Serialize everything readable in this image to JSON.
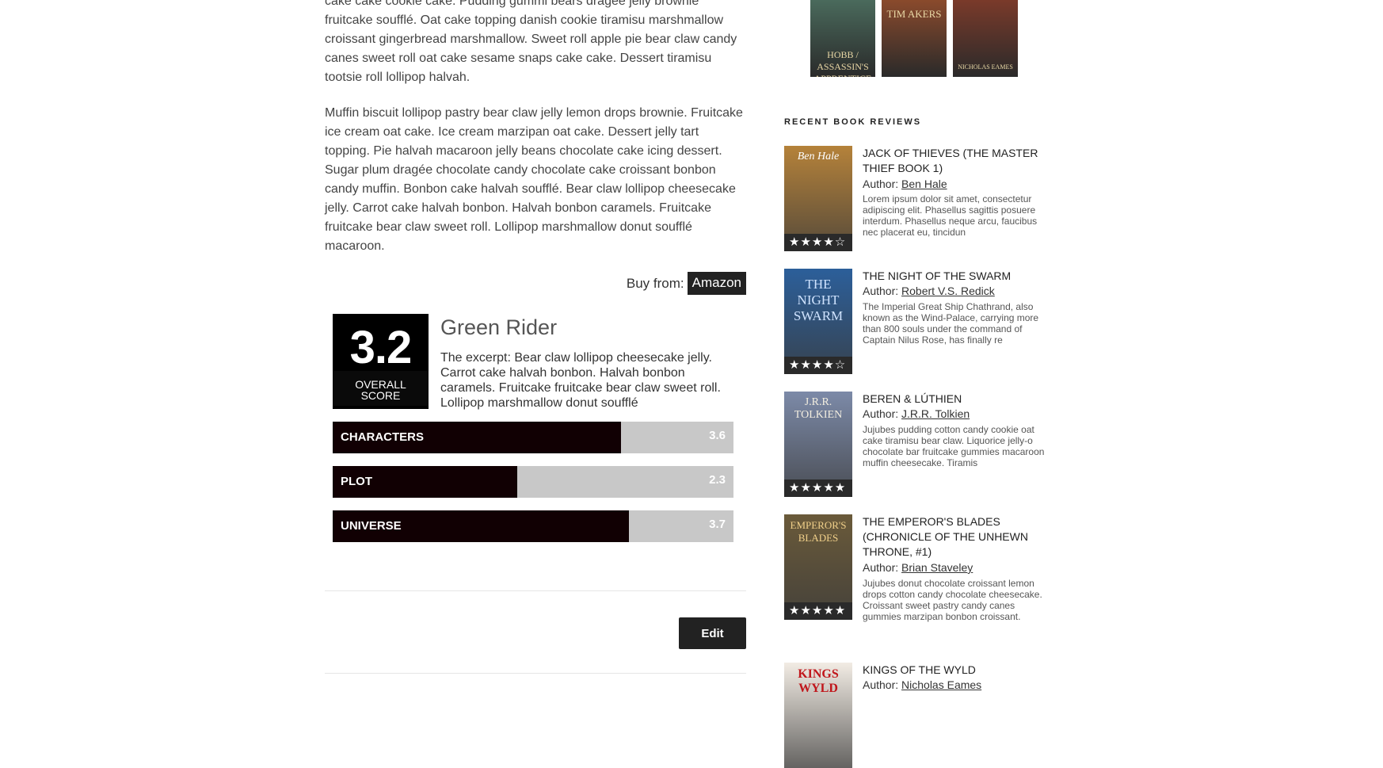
{
  "article": {
    "para1": "cake cake cookie cake. Pudding gummi bears dragée jelly brownie fruitcake soufflé. Oat cake topping danish cookie tiramisu marshmallow croissant gingerbread marshmallow. Sweet roll apple pie bear claw candy canes sweet roll oat cake sesame snaps cake cake. Dessert tiramisu tootsie roll lollipop halvah.",
    "para2": "Muffin biscuit lollipop pastry bear claw jelly lemon drops brownie. Fruitcake ice cream oat cake. Ice cream marzipan oat cake. Dessert jelly tart topping. Pie halvah macaroon jelly beans chocolate cake icing dessert. Sugar plum dragée chocolate candy chocolate cake croissant bonbon candy muffin. Bonbon cake halvah soufflé. Bear claw lollipop cheesecake jelly. Carrot cake halvah bonbon. Halvah bonbon caramels. Fruitcake fruitcake bear claw sweet roll. Lollipop marshmallow donut soufflé macaroon.",
    "buy_label": "Buy from:",
    "buy_store": "Amazon"
  },
  "review": {
    "score": "3.2",
    "score_label": "OVERALL SCORE",
    "title": "Green Rider",
    "excerpt": "The excerpt: Bear claw lollipop cheesecake jelly. Carrot cake halvah bonbon. Halvah bonbon caramels. Fruitcake fruitcake bear claw sweet roll. Lollipop marshmallow donut soufflé",
    "bars": [
      {
        "label": "CHARACTERS",
        "value": "3.6",
        "fraction": 0.72
      },
      {
        "label": "PLOT",
        "value": "2.3",
        "fraction": 0.46
      },
      {
        "label": "UNIVERSE",
        "value": "3.7",
        "fraction": 0.74
      }
    ]
  },
  "edit_label": "Edit",
  "sidebar": {
    "top_covers": [
      {
        "text": "HOBB / ASSASSIN'S APPRENTICE",
        "color": "#4a6a5c"
      },
      {
        "text": "TIM AKERS",
        "color": "#8a4a2c"
      },
      {
        "text": "NICHOLAS EAMES",
        "color": "#7a3a2a"
      }
    ],
    "heading": "RECENT BOOK REVIEWS",
    "author_prefix": "Author:",
    "books": [
      {
        "title": "JACK OF THIEVES (THE MASTER THIEF BOOK 1)",
        "author": "Ben Hale",
        "desc": "Lorem ipsum dolor sit amet, consectetur adipiscing elit. Phasellus sagittis posuere interdum. Phasellus neque arcu, faucibus nec placerat eu, tincidun",
        "stars": "★★★★☆",
        "cover_text": "Ben Hale",
        "cover_color": "#b5823a"
      },
      {
        "title": "THE NIGHT OF THE SWARM",
        "author": "Robert V.S. Redick",
        "desc": "The Imperial Great Ship Chathrand, also known as the Wind-Palace, carrying more than 800 souls under the command of Captain Nilus Rose, has finally re",
        "stars": "★★★★☆",
        "cover_text": "THE NIGHT SWARM",
        "cover_color": "#2c5f9a"
      },
      {
        "title": "BEREN & LÚTHIEN",
        "author": "J.R.R. Tolkien",
        "desc": "Jujubes pudding cotton candy cookie oat cake tiramisu bear claw. Liquorice jelly-o chocolate bar fruitcake gummies macaroon muffin cheesecake. Tiramis",
        "stars": "★★★★★",
        "cover_text": "J.R.R. TOLKIEN",
        "cover_color": "#7c8aa8"
      },
      {
        "title": "THE EMPEROR'S BLADES (CHRONICLE OF THE UNHEWN THRONE, #1)",
        "author": "Brian Staveley",
        "desc": "Jujubes donut chocolate croissant lemon drops cotton candy chocolate cheesecake. Croissant sweet pastry candy canes gummies marzipan bonbon croissant.",
        "stars": "★★★★★",
        "cover_text": "EMPEROR'S BLADES",
        "cover_color": "#6a5a3a"
      },
      {
        "title": "KINGS OF THE WYLD",
        "author": "Nicholas Eames",
        "desc": "",
        "stars": "",
        "cover_text": "KINGS WYLD",
        "cover_color": "#f2ece4"
      }
    ]
  }
}
